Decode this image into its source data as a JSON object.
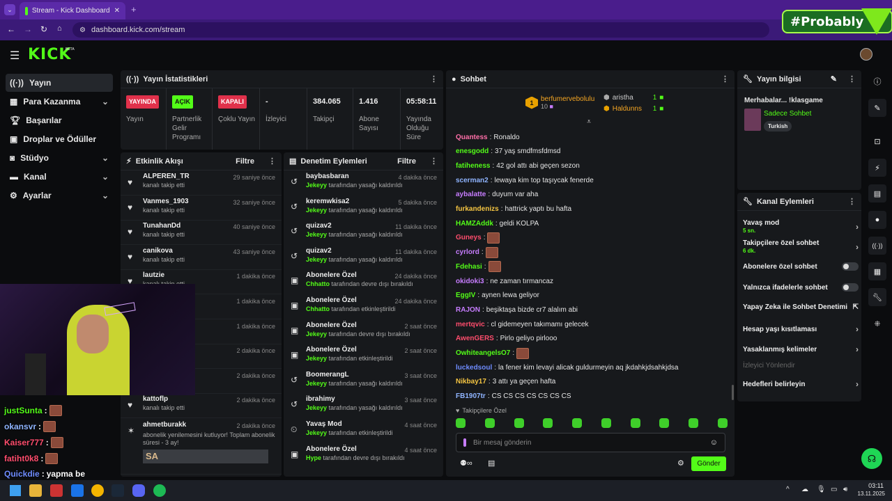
{
  "browser": {
    "tab_title": "Stream - Kick Dashboard",
    "url": "dashboard.kick.com/stream",
    "overlay_brand": "#Probably"
  },
  "logo": "KICK",
  "logo_tag": "BETA",
  "sidebar": {
    "items": [
      {
        "label": "Yayın"
      },
      {
        "label": "Para Kazanma"
      },
      {
        "label": "Başarılar"
      },
      {
        "label": "Droplar ve Ödüller"
      },
      {
        "label": "Stüdyo"
      },
      {
        "label": "Kanal"
      },
      {
        "label": "Ayarlar"
      }
    ]
  },
  "stats": {
    "title": "Yayın İstatistikleri",
    "cells": [
      {
        "value": "YAYINDA",
        "label": "Yayın"
      },
      {
        "value": "AÇIK",
        "label": "Partnerlik Gelir Programı"
      },
      {
        "value": "KAPALI",
        "label": "Çoklu Yayın"
      },
      {
        "value": "-",
        "label": "İzleyici"
      },
      {
        "value": "384.065",
        "label": "Takipçi"
      },
      {
        "value": "1.416",
        "label": "Abone Sayısı"
      },
      {
        "value": "05:58:11",
        "label": "Yayında Olduğu Süre"
      }
    ]
  },
  "activity": {
    "title": "Etkinlik Akışı",
    "filter": "Filtre",
    "items": [
      {
        "name": "ALPEREN_TR",
        "sub": "kanalı takip etti",
        "time": "29 saniye önce"
      },
      {
        "name": "Vanmes_1903",
        "sub": "kanalı takip etti",
        "time": "32 saniye önce"
      },
      {
        "name": "TunahanDd",
        "sub": "kanalı takip etti",
        "time": "40 saniye önce"
      },
      {
        "name": "canikova",
        "sub": "kanalı takip etti",
        "time": "43 saniye önce"
      },
      {
        "name": "lautzie",
        "sub": "kanalı takip etti",
        "time": "1 dakika önce"
      },
      {
        "name": "",
        "sub": "",
        "time": "1 dakika önce"
      },
      {
        "name": "",
        "sub": "",
        "time": "1 dakika önce"
      },
      {
        "name": "",
        "sub": "",
        "time": "2 dakika önce"
      },
      {
        "name": "",
        "sub": "",
        "time": "2 dakika önce"
      },
      {
        "name": "kattoflp",
        "sub": "kanalı takip etti",
        "time": "2 dakika önce"
      }
    ],
    "resub": {
      "name": "ahmetburakk",
      "time": "2 dakika önce",
      "text": "abonelik yenilemesini kutluyor! Toplam abonelik süresi - 3 ay!",
      "emote": "SA"
    }
  },
  "moderation": {
    "title": "Denetim Eylemleri",
    "filter": "Filtre",
    "items": [
      {
        "name": "baybasbaran",
        "actor": "Jekeyy",
        "action": "tarafından yasağı kaldırıldı",
        "time": "4 dakika önce"
      },
      {
        "name": "keremwkisa2",
        "actor": "Jekeyy",
        "action": "tarafından yasağı kaldırıldı",
        "time": "5 dakika önce"
      },
      {
        "name": "quizav2",
        "actor": "Jekeyy",
        "action": "tarafından yasağı kaldırıldı",
        "time": "11 dakika önce"
      },
      {
        "name": "quizav2",
        "actor": "Jekeyy",
        "action": "tarafından yasağı kaldırıldı",
        "time": "11 dakika önce"
      },
      {
        "name": "Abonelere Özel",
        "actor": "Chhatto",
        "action": "tarafından devre dışı bırakıldı",
        "time": "24 dakika önce"
      },
      {
        "name": "Abonelere Özel",
        "actor": "Chhatto",
        "action": "tarafından etkinleştirildi",
        "time": "24 dakika önce"
      },
      {
        "name": "Abonelere Özel",
        "actor": "Jekeyy",
        "action": "tarafından devre dışı bırakıldı",
        "time": "2 saat önce"
      },
      {
        "name": "Abonelere Özel",
        "actor": "Jekeyy",
        "action": "tarafından etkinleştirildi",
        "time": "2 saat önce"
      },
      {
        "name": "BoomerangL",
        "actor": "Jekeyy",
        "action": "tarafından yasağı kaldırıldı",
        "time": "3 saat önce"
      },
      {
        "name": "ibrahimy",
        "actor": "Jekeyy",
        "action": "tarafından yasağı kaldırıldı",
        "time": "3 saat önce"
      },
      {
        "name": "Yavaş Mod",
        "actor": "Jekeyy",
        "action": "tarafından etkinleştirildi",
        "time": "4 saat önce"
      },
      {
        "name": "Abonelere Özel",
        "actor": "Hype",
        "action": "tarafından devre dışı bırakıldı",
        "time": "4 saat önce"
      }
    ]
  },
  "chat": {
    "title": "Sohbet",
    "top": [
      {
        "rank": "1",
        "name": "berfumervebolulu",
        "count": "10"
      },
      {
        "name": "aristha",
        "count": "1"
      },
      {
        "name": "Haldunns",
        "count": "1"
      }
    ],
    "messages": [
      {
        "user": "Quantess",
        "text": "Ronaldo",
        "color": "#ff6fa8"
      },
      {
        "user": "enesgodd",
        "text": "37 yaş smdfmsfdmsd",
        "color": "#53fc18"
      },
      {
        "user": "fatiheness",
        "text": "42 gol attı abi geçen sezon",
        "color": "#53fc18"
      },
      {
        "user": "scerman2",
        "text": "lewaya kim top taşıycak fenerde",
        "color": "#8fb4ff"
      },
      {
        "user": "aybalatte",
        "text": "duyum var aha",
        "color": "#c77dff"
      },
      {
        "user": "furkandenizs",
        "text": "hattrick yaptı bu hafta",
        "color": "#f5c542"
      },
      {
        "user": "HAMZAddk",
        "text": "geldi KOLPA",
        "color": "#53fc18"
      },
      {
        "user": "Guneys",
        "text": "",
        "color": "#ff4d6d"
      },
      {
        "user": "cyrlord",
        "text": "",
        "color": "#c77dff"
      },
      {
        "user": "Fdehasi",
        "text": "",
        "color": "#53fc18"
      },
      {
        "user": "okidoki3",
        "text": "ne zaman tırmancaz",
        "color": "#c77dff"
      },
      {
        "user": "EggIV",
        "text": "aynen lewa geliyor",
        "color": "#53fc18"
      },
      {
        "user": "RAJON",
        "text": "beşiktaşa bizde cr7 alalım abi",
        "color": "#c77dff"
      },
      {
        "user": "mertqvic",
        "text": "cl gidemeyen takımamı gelecek",
        "color": "#ff4d6d"
      },
      {
        "user": "AwenGERS",
        "text": "Pirlo geliyo pirlooo",
        "color": "#ff4d6d"
      },
      {
        "user": "OwhiteangelsO7",
        "text": "",
        "color": "#53fc18"
      },
      {
        "user": "luckedsoul",
        "text": "la fener kim levayi alicak guldurmeyin aq jkdahkjdsahkjdsa",
        "color": "#6f8cff"
      },
      {
        "user": "Nikbay17",
        "text": "3 attı ya geçen hafta",
        "color": "#f5c542"
      },
      {
        "user": "FB1907tr",
        "text": "CS CS CS CS CS CS CS",
        "color": "#8fb4ff"
      }
    ],
    "followers_only": "Takipçilere Özel",
    "placeholder": "Bir mesaj gönderin",
    "send": "Gönder"
  },
  "stream_info": {
    "title": "Yayın bilgisi",
    "stream_title": "Merhabalar... !klasgame",
    "category": "Sadece Sohbet",
    "tag": "Turkish"
  },
  "channel_actions": {
    "title": "Kanal Eylemleri",
    "items": [
      {
        "label": "Yavaş mod",
        "sub": "5 sn."
      },
      {
        "label": "Takipçilere özel sohbet",
        "sub": "6 dk."
      },
      {
        "label": "Abonelere özel sohbet",
        "sub": ""
      },
      {
        "label": "Yalnızca ifadelerle sohbet",
        "sub": ""
      },
      {
        "label": "Yapay Zeka ile Sohbet Denetimi",
        "sub": ""
      },
      {
        "label": "Hesap yaşı kısıtlaması",
        "sub": ""
      },
      {
        "label": "Yasaklanmış kelimeler",
        "sub": ""
      },
      {
        "label": "İzleyici Yönlendir",
        "sub": ""
      },
      {
        "label": "Hedefleri belirleyin",
        "sub": ""
      }
    ]
  },
  "overlay_chat": [
    {
      "user": "justSunta",
      "text": "",
      "color": "#53fc18"
    },
    {
      "user": "okansvr",
      "text": "",
      "color": "#8fb4ff"
    },
    {
      "user": "Kaiser777",
      "text": "",
      "color": "#ff4d6d"
    },
    {
      "user": "fatiht0k8",
      "text": "",
      "color": "#ff4d6d"
    },
    {
      "user": "Quickdie",
      "text": "yapma be",
      "color": "#6f8cff"
    }
  ],
  "clock": {
    "time": "03:11",
    "date": "13.11.2025"
  },
  "colors": {
    "accent": "#53fc18",
    "live": "#e0314b",
    "panel": "#17191c",
    "browser": "#4a1d8c"
  }
}
